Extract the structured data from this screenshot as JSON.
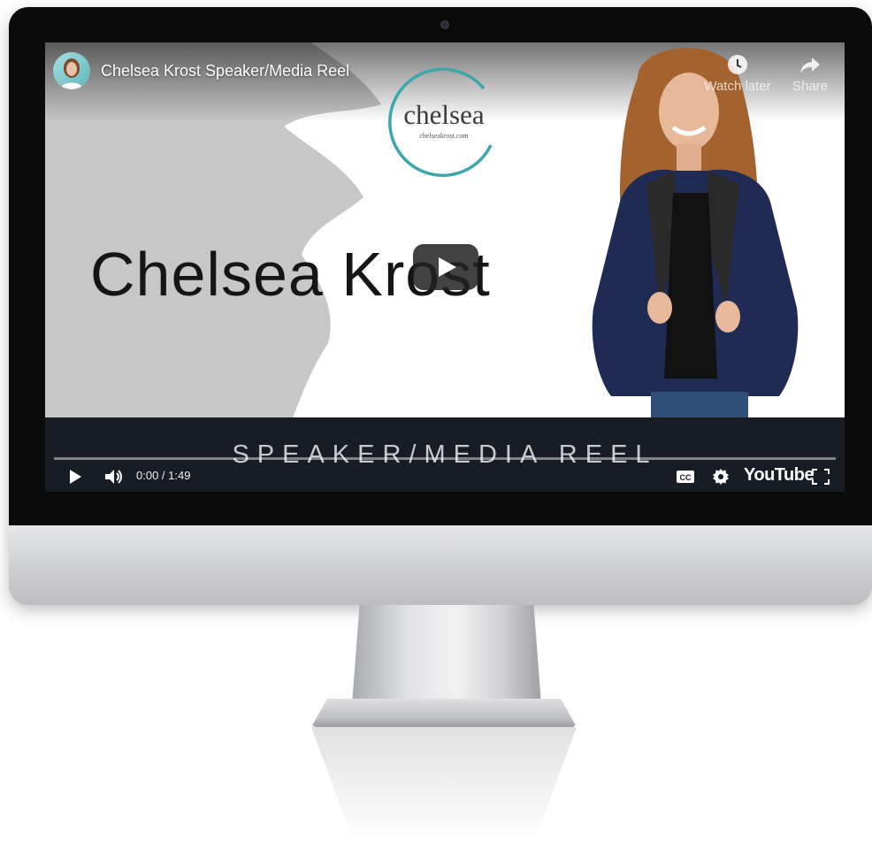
{
  "video": {
    "title": "Chelsea Krost Speaker/Media Reel",
    "logo_word": "chelsea",
    "logo_url": "chelseakrost.com",
    "headline": "Chelsea Krost",
    "banner_text": "SPEAKER/MEDIA REEL",
    "progress": 0,
    "accent_color": "#3ba7ad"
  },
  "top_actions": {
    "watch_later": "Watch later",
    "share": "Share"
  },
  "controls": {
    "time": "0:00 / 1:49",
    "brand": "YouTube",
    "icons": [
      "play-icon",
      "volume-icon",
      "captions-icon",
      "settings-icon",
      "fullscreen-icon"
    ]
  }
}
